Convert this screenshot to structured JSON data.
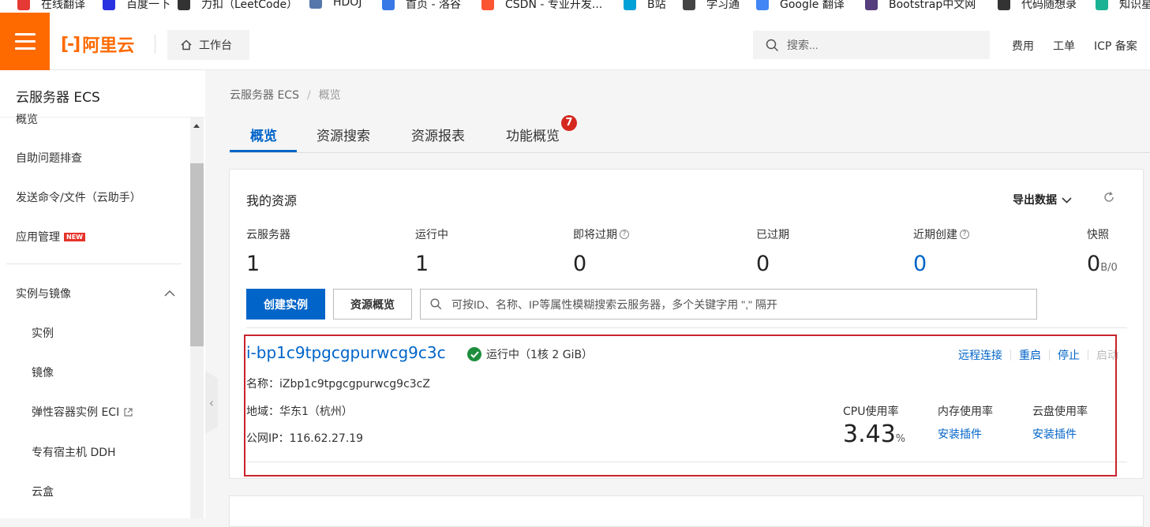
{
  "bookmarks": [
    {
      "label": "在线翻译",
      "icon": "translate-icon",
      "color": "#e53935"
    },
    {
      "label": "百度一下",
      "icon": "baidu-paw-icon",
      "color": "#2932e1"
    },
    {
      "label": "力扣（LeetCode）",
      "icon": "leetcode-icon",
      "color": "#333333"
    },
    {
      "label": "HDOJ",
      "icon": "hdoj-icon",
      "color": "#5577aa"
    },
    {
      "label": "首页 - 洛谷",
      "icon": "luogu-icon",
      "color": "#3778e6"
    },
    {
      "label": "CSDN - 专业开发...",
      "icon": "csdn-icon",
      "color": "#fc5531"
    },
    {
      "label": "B站",
      "icon": "bilibili-icon",
      "color": "#00a1d6"
    },
    {
      "label": "学习通",
      "icon": "globe-icon",
      "color": "#444444"
    },
    {
      "label": "Google 翻译",
      "icon": "google-translate-icon",
      "color": "#4285f4"
    },
    {
      "label": "Bootstrap中文网",
      "icon": "bootstrap-icon",
      "color": "#563d7c"
    },
    {
      "label": "代码随想录",
      "icon": "code-icon",
      "color": "#333333"
    },
    {
      "label": "知识星",
      "icon": "ring-icon",
      "color": "#19b394"
    }
  ],
  "header": {
    "logo_text": "阿里云",
    "logo_mark": "[-]",
    "workbench_label": "工作台",
    "search_placeholder": "搜索...",
    "links": [
      "费用",
      "工单",
      "ICP 备案"
    ]
  },
  "sidebar": {
    "title": "云服务器 ECS",
    "items": [
      {
        "label": "概览",
        "sub": false
      },
      {
        "label": "自助问题排查",
        "sub": false
      },
      {
        "label": "发送命令/文件（云助手）",
        "sub": false
      },
      {
        "label": "应用管理",
        "sub": false,
        "badge": "NEW"
      },
      {
        "label": "实例与镜像",
        "sub": false,
        "expanded": true
      },
      {
        "label": "实例",
        "sub": true
      },
      {
        "label": "镜像",
        "sub": true
      },
      {
        "label": "弹性容器实例 ECI",
        "sub": true,
        "external": true
      },
      {
        "label": "专有宿主机 DDH",
        "sub": true
      },
      {
        "label": "云盒",
        "sub": true
      }
    ]
  },
  "breadcrumb": [
    "云服务器 ECS",
    "概览"
  ],
  "tabs": [
    {
      "label": "概览",
      "active": true
    },
    {
      "label": "资源搜索",
      "active": false
    },
    {
      "label": "资源报表",
      "active": false
    },
    {
      "label": "功能概览",
      "active": false,
      "badge": "7"
    }
  ],
  "resources": {
    "title": "我的资源",
    "export_label": "导出数据",
    "stats": [
      {
        "label": "云服务器",
        "value": "1",
        "help": false
      },
      {
        "label": "运行中",
        "value": "1",
        "help": false
      },
      {
        "label": "即将过期",
        "value": "0",
        "help": true
      },
      {
        "label": "已过期",
        "value": "0",
        "help": false
      },
      {
        "label": "近期创建",
        "value": "0",
        "help": true,
        "highlight": true
      },
      {
        "label": "快照",
        "value": "0",
        "unit": "B/0",
        "help": false
      }
    ],
    "create_button": "创建实例",
    "overview_button": "资源概览",
    "search_placeholder": "可按ID、名称、IP等属性模糊搜索云服务器，多个关键字用 \",\" 隔开"
  },
  "instance": {
    "id": "i-bp1c9tpgcgpurwcg9c3c",
    "status": "运行中（1核 2 GiB）",
    "actions": [
      "远程连接",
      "重启",
      "停止",
      "启动"
    ],
    "name_line": "名称：iZbp1c9tpgcgpurwcg9c3cZ",
    "region_line": "地域：华东1（杭州）",
    "ip_line": "公网IP：116.62.27.19",
    "metrics": {
      "cpu_label": "CPU使用率",
      "cpu_value": "3.43",
      "cpu_unit": "%",
      "mem_label": "内存使用率",
      "mem_link": "安装插件",
      "disk_label": "云盘使用率",
      "disk_link": "安装插件"
    }
  },
  "colors": {
    "brand": "#ff6a00",
    "primary": "#0064c8",
    "success": "#1e8e3e",
    "danger": "#c8232c"
  }
}
